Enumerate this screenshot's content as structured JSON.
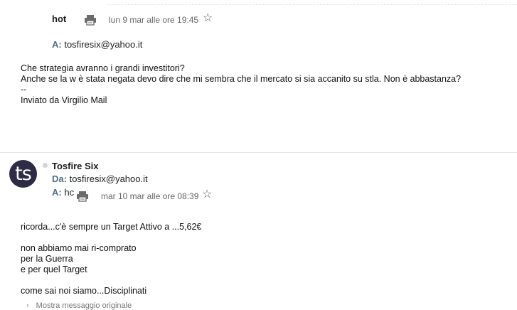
{
  "message1": {
    "sender": "hot",
    "date": "lun 9 mar alle ore 19:45",
    "to_label": "A:",
    "to_value": "tosfiresix@yahoo.it",
    "body": [
      "Che strategia avranno i grandi investitori?",
      "Anche se la w è stata negata devo dire che mi sembra che il mercato si sia accanito su stla. Non è abbastanza?",
      "--",
      "Inviato da Virgilio Mail"
    ]
  },
  "message2": {
    "avatar_initials": "ts",
    "sender": "Tosfire Six",
    "from_label": "Da:",
    "from_value": "tosfiresix@yahoo.it",
    "to_label": "A:",
    "to_value": "hc",
    "date": "mar 10 mar alle ore 08:39",
    "body": [
      "ricorda...c'è sempre un Target Attivo a ...5,62€",
      "",
      "non abbiamo mai ri-comprato",
      "per la Guerra",
      "e per quel Target",
      "",
      "come sai noi siamo...Disciplinati"
    ],
    "show_original_label": "Mostra messaggio originale"
  },
  "icons": {
    "star": "star-outline-icon",
    "print": "printer-icon",
    "presence": "presence-dot-icon",
    "expand": "chevron-right-icon"
  },
  "colors": {
    "avatar_bg": "#2e2c45",
    "label_blue": "#4f6f8a",
    "meta_gray": "#666666"
  }
}
